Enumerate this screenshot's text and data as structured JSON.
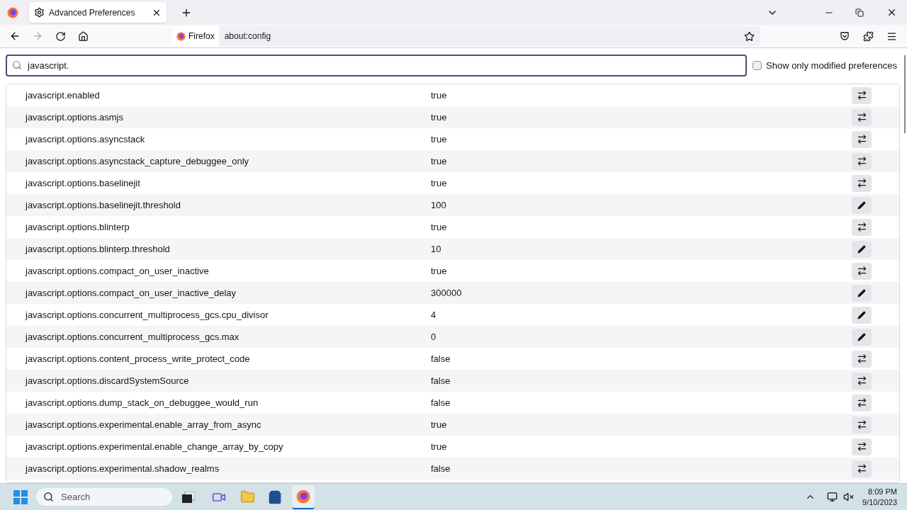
{
  "tab": {
    "title": "Advanced Preferences"
  },
  "urlbar": {
    "identity": "Firefox",
    "url": "about:config"
  },
  "search": {
    "value": "javascript."
  },
  "modified_only": {
    "label": "Show only modified preferences",
    "checked": false
  },
  "prefs": [
    {
      "name": "javascript.enabled",
      "value": "true",
      "kind": "toggle"
    },
    {
      "name": "javascript.options.asmjs",
      "value": "true",
      "kind": "toggle"
    },
    {
      "name": "javascript.options.asyncstack",
      "value": "true",
      "kind": "toggle"
    },
    {
      "name": "javascript.options.asyncstack_capture_debuggee_only",
      "value": "true",
      "kind": "toggle"
    },
    {
      "name": "javascript.options.baselinejit",
      "value": "true",
      "kind": "toggle"
    },
    {
      "name": "javascript.options.baselinejit.threshold",
      "value": "100",
      "kind": "edit"
    },
    {
      "name": "javascript.options.blinterp",
      "value": "true",
      "kind": "toggle"
    },
    {
      "name": "javascript.options.blinterp.threshold",
      "value": "10",
      "kind": "edit"
    },
    {
      "name": "javascript.options.compact_on_user_inactive",
      "value": "true",
      "kind": "toggle"
    },
    {
      "name": "javascript.options.compact_on_user_inactive_delay",
      "value": "300000",
      "kind": "edit"
    },
    {
      "name": "javascript.options.concurrent_multiprocess_gcs.cpu_divisor",
      "value": "4",
      "kind": "edit"
    },
    {
      "name": "javascript.options.concurrent_multiprocess_gcs.max",
      "value": "0",
      "kind": "edit"
    },
    {
      "name": "javascript.options.content_process_write_protect_code",
      "value": "false",
      "kind": "toggle"
    },
    {
      "name": "javascript.options.discardSystemSource",
      "value": "false",
      "kind": "toggle"
    },
    {
      "name": "javascript.options.dump_stack_on_debuggee_would_run",
      "value": "false",
      "kind": "toggle"
    },
    {
      "name": "javascript.options.experimental.enable_array_from_async",
      "value": "true",
      "kind": "toggle"
    },
    {
      "name": "javascript.options.experimental.enable_change_array_by_copy",
      "value": "true",
      "kind": "toggle"
    },
    {
      "name": "javascript.options.experimental.shadow_realms",
      "value": "false",
      "kind": "toggle"
    }
  ],
  "taskbar": {
    "search_placeholder": "Search",
    "time": "8:09 PM",
    "date": "9/10/2023"
  }
}
